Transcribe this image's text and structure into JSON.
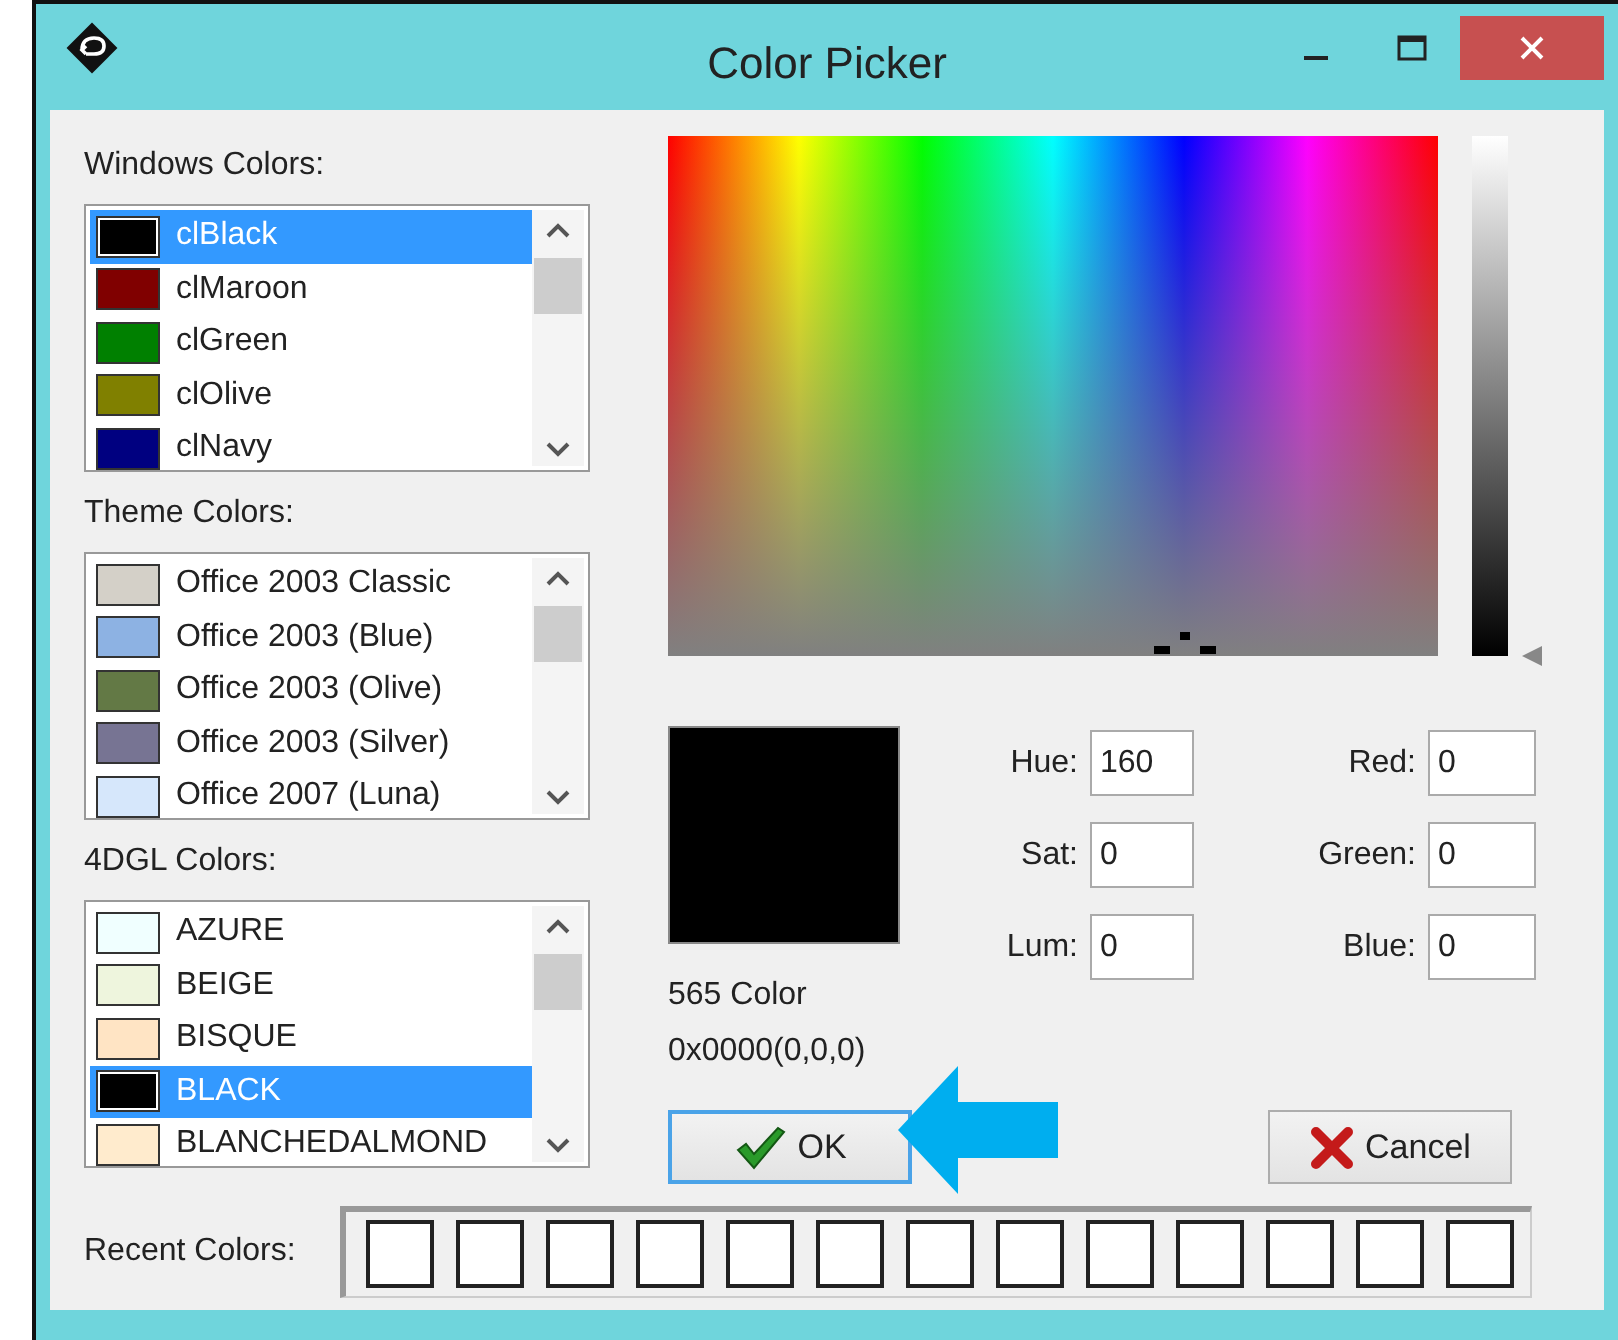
{
  "window": {
    "title": "Color Picker"
  },
  "lists": [
    {
      "label": "Windows Colors:",
      "items": [
        {
          "name": "clBlack",
          "color": "#000000",
          "selected": true
        },
        {
          "name": "clMaroon",
          "color": "#800000",
          "selected": false
        },
        {
          "name": "clGreen",
          "color": "#008000",
          "selected": false
        },
        {
          "name": "clOlive",
          "color": "#808000",
          "selected": false
        },
        {
          "name": "clNavy",
          "color": "#000080",
          "selected": false
        }
      ]
    },
    {
      "label": "Theme Colors:",
      "items": [
        {
          "name": "Office 2003 Classic",
          "color": "#d4d0c8",
          "selected": false
        },
        {
          "name": "Office 2003 (Blue)",
          "color": "#8db2e3",
          "selected": false
        },
        {
          "name": "Office 2003 (Olive)",
          "color": "#637945",
          "selected": false
        },
        {
          "name": "Office 2003 (Silver)",
          "color": "#777493",
          "selected": false
        },
        {
          "name": "Office 2007 (Luna)",
          "color": "#d6e7fb",
          "selected": false
        }
      ]
    },
    {
      "label": "4DGL Colors:",
      "items": [
        {
          "name": "AZURE",
          "color": "#f0ffff",
          "selected": false
        },
        {
          "name": "BEIGE",
          "color": "#eef5dd",
          "selected": false
        },
        {
          "name": "BISQUE",
          "color": "#ffe4c4",
          "selected": false
        },
        {
          "name": "BLACK",
          "color": "#000000",
          "selected": true
        },
        {
          "name": "BLANCHEDALMOND",
          "color": "#ffebcd",
          "selected": false
        }
      ]
    }
  ],
  "luminance": {
    "level": 0
  },
  "preview": {
    "color": "#000000",
    "format_label": "565 Color",
    "value": "0x0000(0,0,0)"
  },
  "hsl_fields": [
    {
      "label": "Hue:",
      "value": "160"
    },
    {
      "label": "Sat:",
      "value": "0"
    },
    {
      "label": "Lum:",
      "value": "0"
    }
  ],
  "rgb_fields": [
    {
      "label": "Red:",
      "value": "0"
    },
    {
      "label": "Green:",
      "value": "0"
    },
    {
      "label": "Blue:",
      "value": "0"
    }
  ],
  "buttons": [
    {
      "label": "OK",
      "kind": "ok",
      "focused": true
    },
    {
      "label": "Cancel",
      "kind": "cancel",
      "focused": false
    }
  ],
  "recent_colors": {
    "label": "Recent Colors:",
    "slots": [
      {
        "empty": true
      },
      {
        "empty": true
      },
      {
        "empty": true
      },
      {
        "empty": true
      },
      {
        "empty": true
      },
      {
        "empty": true
      },
      {
        "empty": true
      },
      {
        "empty": true
      },
      {
        "empty": true
      },
      {
        "empty": true
      },
      {
        "empty": true
      },
      {
        "empty": true
      },
      {
        "empty": true
      }
    ]
  }
}
